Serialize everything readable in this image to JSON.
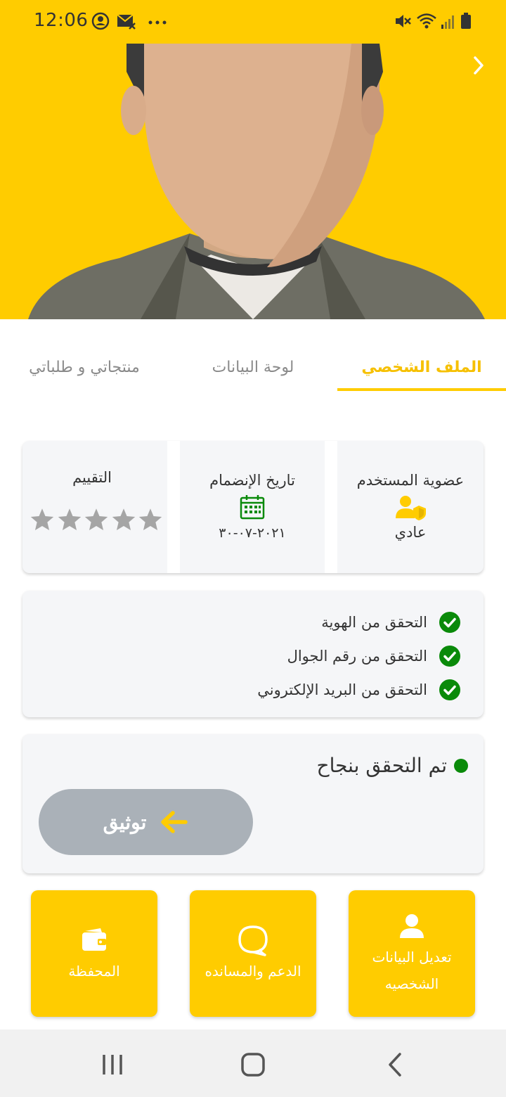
{
  "status_bar": {
    "time": "12:06",
    "icons": [
      "account-circle-icon",
      "mail-off-icon",
      "more-dots-icon",
      "mute-icon",
      "wifi-icon",
      "signal-icon",
      "battery-icon"
    ]
  },
  "hero": {
    "image": "default-avatar",
    "forward_icon": "chevron-right-icon"
  },
  "tabs": [
    {
      "label": "الملف الشخصي",
      "active": true
    },
    {
      "label": "لوحة البيانات",
      "active": false
    },
    {
      "label": "منتجاتي و طلباتي",
      "active": false
    }
  ],
  "profile_info": {
    "membership": {
      "title": "عضوية المستخدم",
      "value": "عادي",
      "icon": "user-shield-icon"
    },
    "join_date": {
      "title": "تاريخ الإنضمام",
      "value": "٢٠٢١-٠٧-٣٠",
      "icon": "calendar-icon"
    },
    "rating": {
      "title": "التقييم",
      "stars_filled": 0,
      "stars_total": 5
    }
  },
  "verifications": [
    {
      "label": "التحقق من الهوية",
      "verified": true
    },
    {
      "label": "التحقق من رقم الجوال",
      "verified": true
    },
    {
      "label": "التحقق من البريد الإلكتروني",
      "verified": true
    }
  ],
  "verification_status": {
    "text": "تم التحقق بنجاح",
    "button_label": "توثيق"
  },
  "actions": [
    {
      "label_line1": "تعديل البيانات",
      "label_line2": "الشخصيه",
      "icon": "user-icon"
    },
    {
      "label": "الدعم والمسانده",
      "icon": "chat-bubble-icon"
    },
    {
      "label": "المحفظة",
      "icon": "wallet-icon"
    }
  ],
  "colors": {
    "brand": "#FFCC00",
    "verified": "#0A8A0A",
    "button_disabled": "#AAB1B8",
    "card_bg": "#F5F6F8"
  }
}
